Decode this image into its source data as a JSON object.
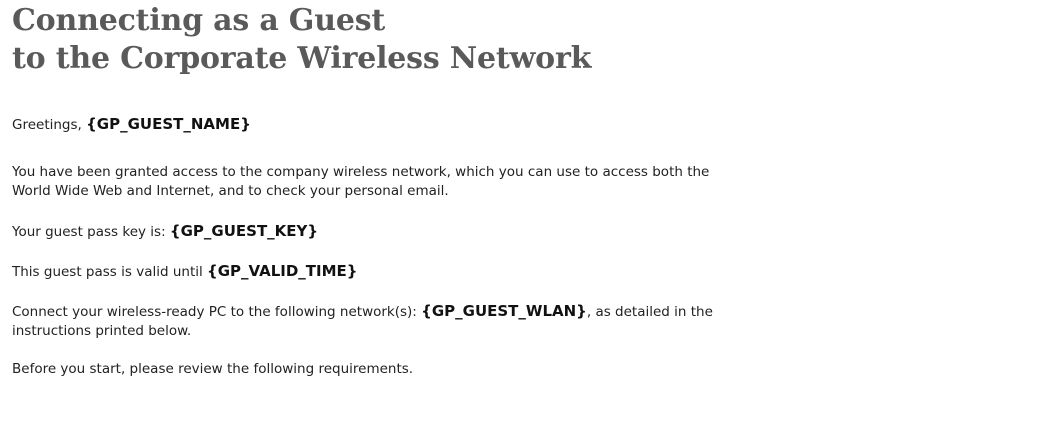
{
  "heading": {
    "line1": "Connecting as a Guest",
    "line2": "to the Corporate Wireless Network"
  },
  "greeting": {
    "prefix": "Greetings, ",
    "name_var": "{GP_GUEST_NAME}"
  },
  "access_paragraph": {
    "line1": "You have been granted access to the company wireless network, which you can use to access both the",
    "line2": "World Wide Web and Internet, and to check your personal email."
  },
  "key": {
    "prefix": "Your guest pass key is: ",
    "key_var": "{GP_GUEST_KEY}"
  },
  "valid": {
    "prefix": "This guest pass is valid until ",
    "time_var": "{GP_VALID_TIME}"
  },
  "connect": {
    "prefix": "Connect your wireless-ready PC to the following network(s): ",
    "wlan_var": "{GP_GUEST_WLAN}",
    "suffix": ", as detailed in the",
    "line2": "instructions printed below."
  },
  "review": {
    "text": "Before you start, please review the following requirements."
  },
  "colors": {
    "heading": "#5a5a5a",
    "body_text": "#222222",
    "background": "#ffffff"
  }
}
